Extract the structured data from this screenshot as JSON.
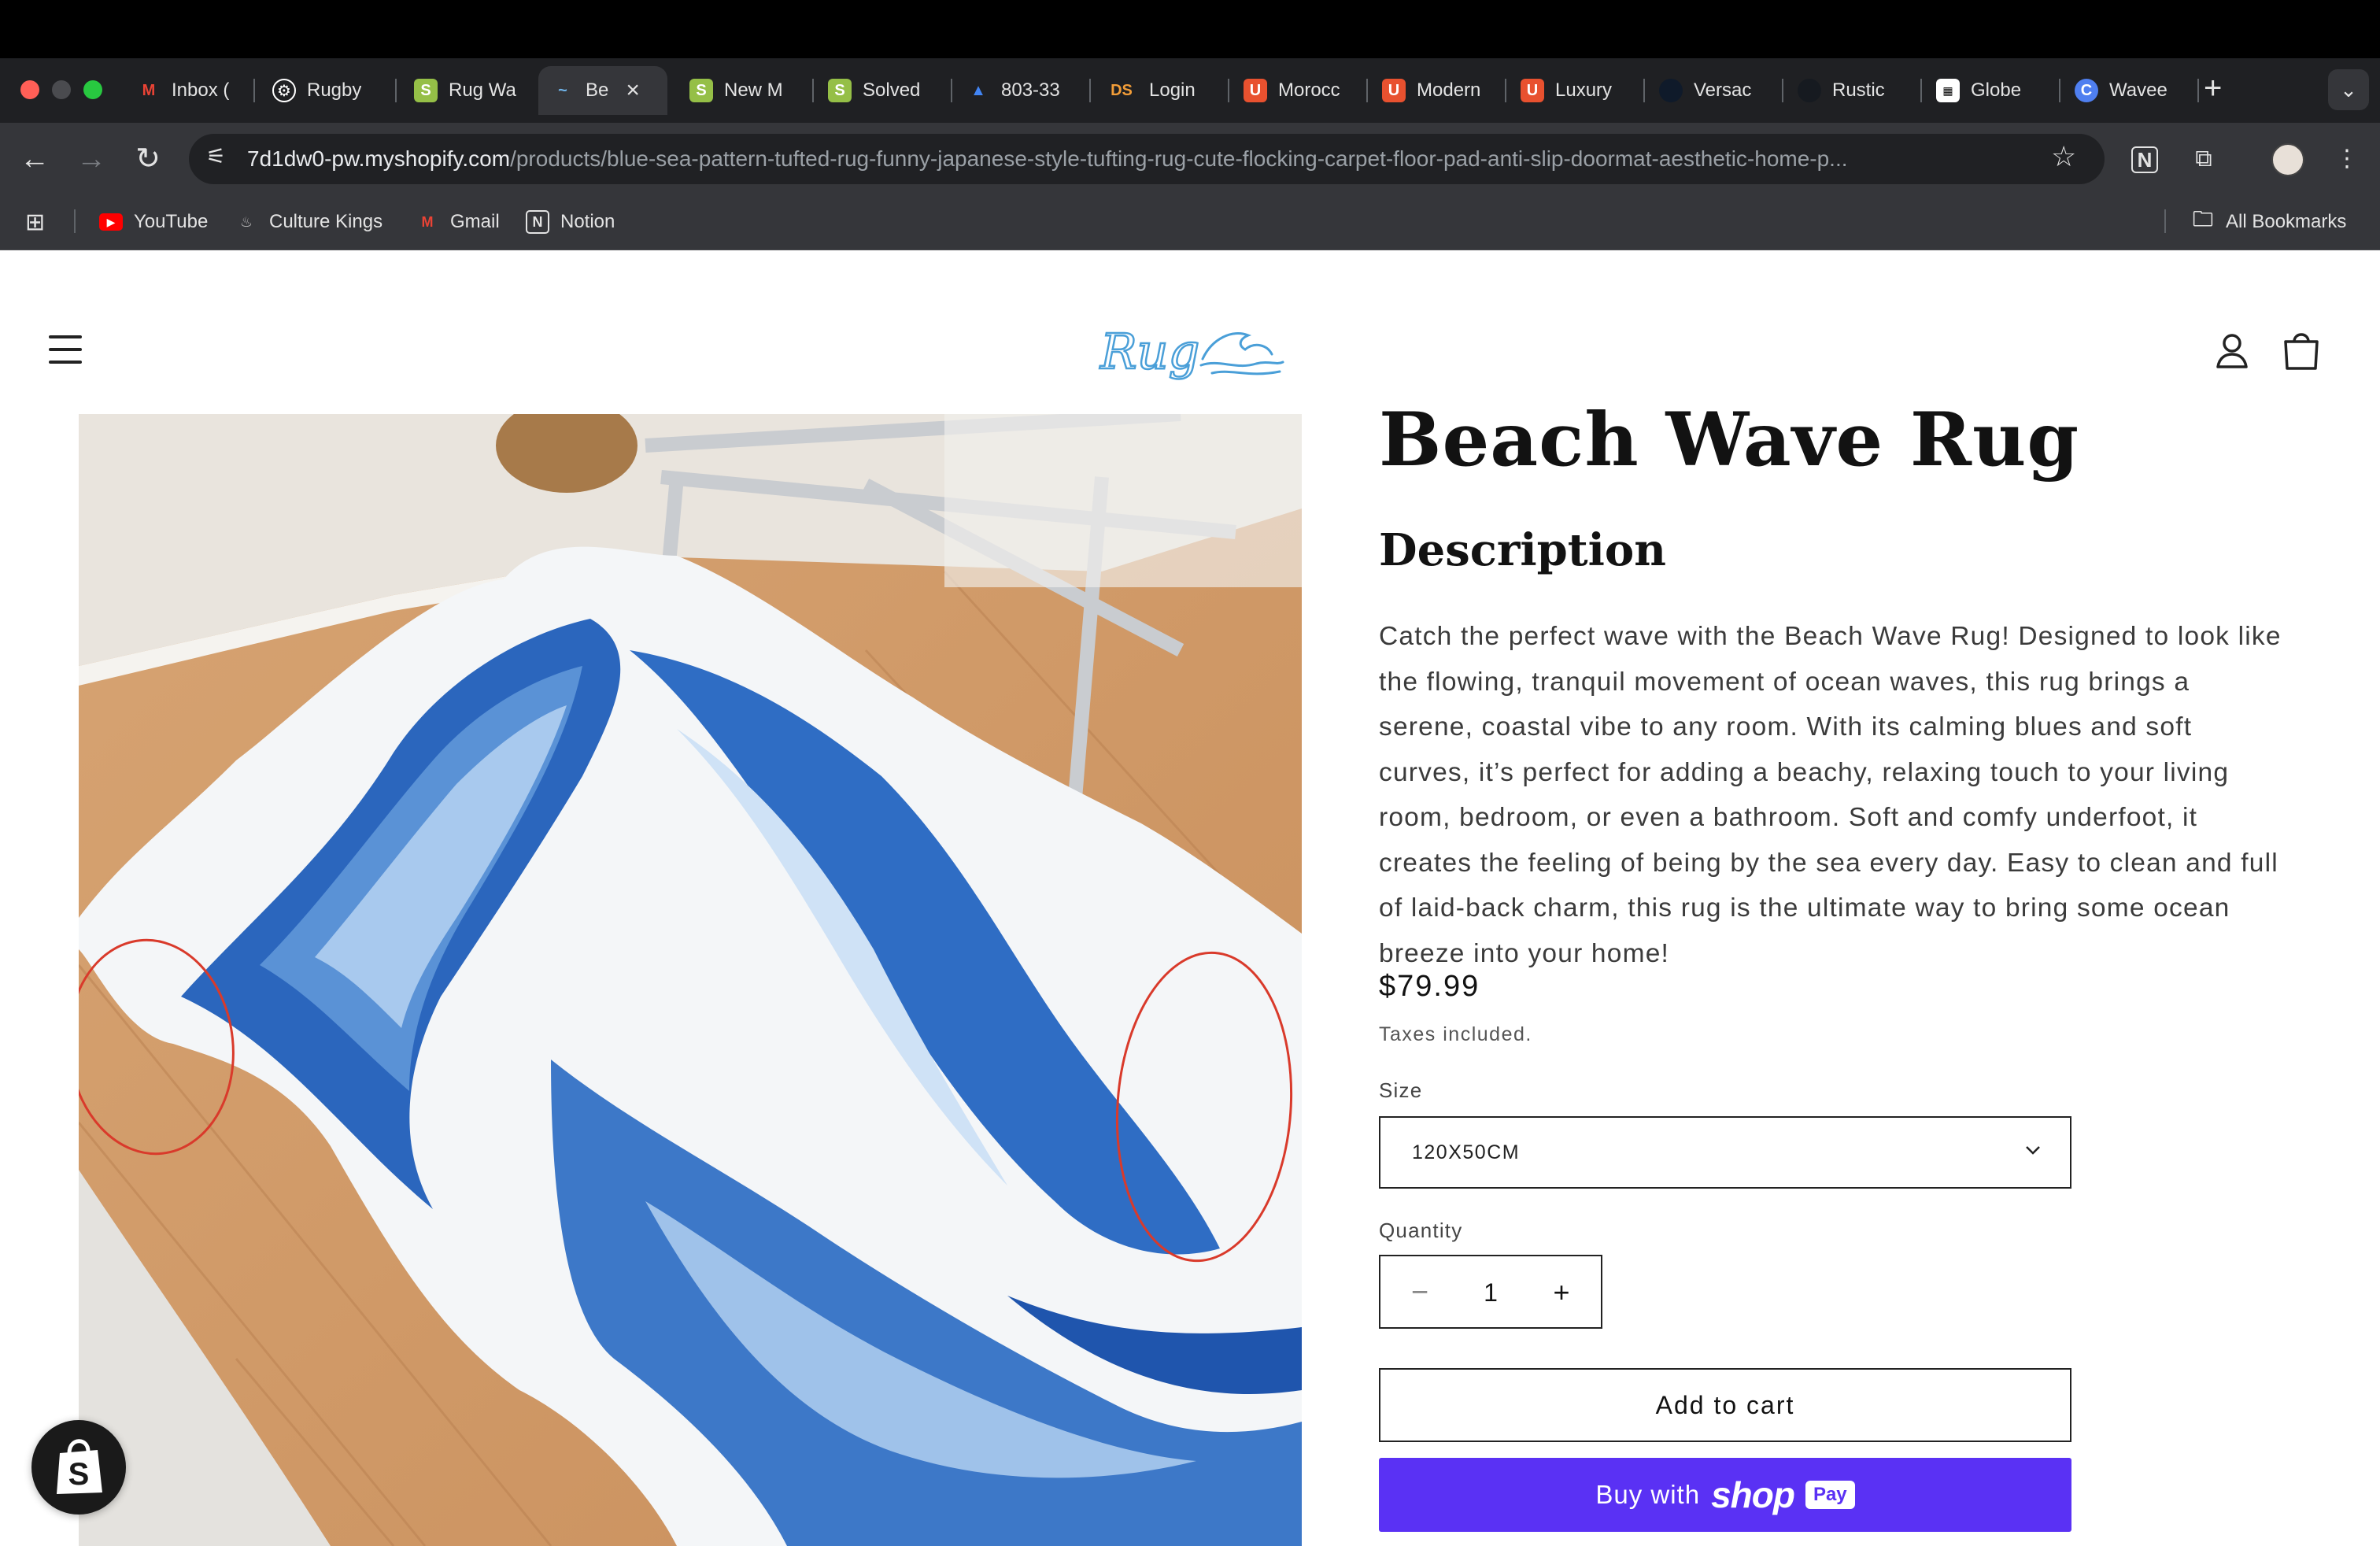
{
  "browser": {
    "tabs": [
      {
        "title": "Inbox (",
        "icon": "gmail-icon"
      },
      {
        "title": "Rugby",
        "icon": "openai-icon"
      },
      {
        "title": "Rug Wa",
        "icon": "shopify-icon"
      },
      {
        "title": "Be",
        "icon": "wave-icon",
        "active": true
      },
      {
        "title": "New M",
        "icon": "shopify-icon"
      },
      {
        "title": "Solved",
        "icon": "shopify-icon"
      },
      {
        "title": "803-33",
        "icon": "google-ads-icon"
      },
      {
        "title": "Login",
        "icon": "ds-icon"
      },
      {
        "title": "Morocc",
        "icon": "store-icon"
      },
      {
        "title": "Modern",
        "icon": "store-icon"
      },
      {
        "title": "Luxury",
        "icon": "store-icon"
      },
      {
        "title": "Versac",
        "icon": "dark-circle-icon"
      },
      {
        "title": "Rustic",
        "icon": "dark-circle-icon"
      },
      {
        "title": "Globe",
        "icon": "globe-icon"
      },
      {
        "title": "Wavee",
        "icon": "canva-icon"
      }
    ],
    "url_host": "7d1dw0-pw.myshopify.com",
    "url_path": "/products/blue-sea-pattern-tufted-rug-funny-japanese-style-tufting-rug-cute-flocking-carpet-floor-pad-anti-slip-doormat-aesthetic-home-p...",
    "bookmarks": [
      {
        "label": "YouTube",
        "icon": "youtube-icon"
      },
      {
        "label": "Culture Kings",
        "icon": "flame-icon"
      },
      {
        "label": "Gmail",
        "icon": "gmail-icon"
      },
      {
        "label": "Notion",
        "icon": "notion-icon"
      }
    ],
    "all_bookmarks": "All Bookmarks"
  },
  "store": {
    "logo_text": "Rug"
  },
  "product": {
    "title": "Beach Wave Rug",
    "description_heading": "Description",
    "description": "Catch the perfect wave with the Beach Wave Rug! Designed to look like the flowing, tranquil movement of ocean waves, this rug brings a serene, coastal vibe to any room. With its calming blues and soft curves, it’s perfect for adding a beachy, relaxing touch to your living room, bedroom, or even a bathroom. Soft and comfy underfoot, it creates the feeling of being by the sea every day. Easy to clean and full of laid-back charm, this rug is the ultimate way to bring some ocean breeze into your home!",
    "price": "$79.99",
    "taxes_note": "Taxes included.",
    "size_label": "Size",
    "size_value": "120X50CM",
    "quantity_label": "Quantity",
    "quantity_value": "1",
    "minus": "−",
    "plus": "+",
    "add_to_cart": "Add to cart",
    "buy_with": "Buy with",
    "shop_word": "shop",
    "pay_word": "Pay"
  },
  "colors": {
    "shop_pay": "#5a31f4",
    "annotation_red": "#d93a2b",
    "logo_blue": "#4a9fd8"
  }
}
